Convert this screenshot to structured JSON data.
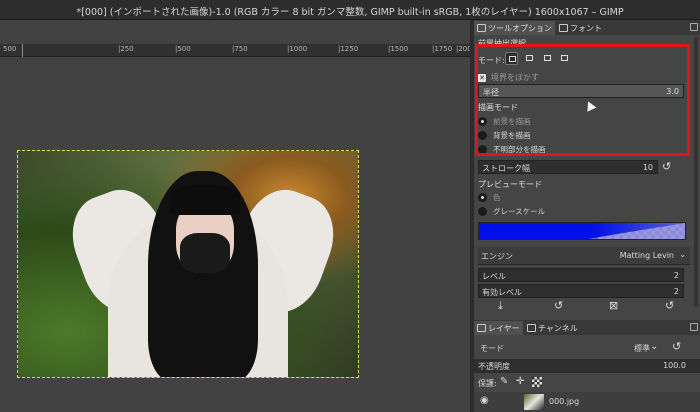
{
  "window": {
    "title": "*[000] (インポートされた画像)-1.0 (RGB カラー 8 bit ガンマ整数, GIMP built-in sRGB, 1枚のレイヤー) 1600x1067 – GIMP"
  },
  "ruler": {
    "labels": [
      "500",
      "|250",
      "|500",
      "|750",
      "|1000",
      "|1250",
      "|1500",
      "|1750",
      "|200"
    ]
  },
  "tool_options": {
    "tabs": [
      {
        "label": "ツールオプション",
        "icon": "tool-options-icon"
      },
      {
        "label": "フォント",
        "icon": "font-icon"
      }
    ],
    "section_title": "前景抽出選択",
    "mode_label": "モード:",
    "mode_buttons": [
      "replace-mode",
      "add-mode",
      "subtract-mode",
      "intersect-mode"
    ],
    "feather": {
      "label": "境界をぼかす",
      "checked": true
    },
    "radius": {
      "label": "半径",
      "value": "3.0"
    },
    "draw_mode": {
      "title": "描画モード",
      "options": [
        {
          "label": "前景を描画",
          "selected": true
        },
        {
          "label": "背景を描画",
          "selected": false
        },
        {
          "label": "不明部分を描画",
          "selected": false
        }
      ]
    },
    "stroke_width": {
      "label": "ストローク幅",
      "value": "10"
    },
    "preview_mode": {
      "title": "プレビューモード",
      "options": [
        {
          "label": "色",
          "selected": true
        },
        {
          "label": "グレースケール",
          "selected": false
        }
      ]
    },
    "preview_color": "#0010e8",
    "engine": {
      "label": "エンジン",
      "value": "Matting Levin"
    },
    "level": {
      "label": "レベル",
      "value": "2"
    },
    "active_levels": {
      "label": "有効レベル",
      "value": "2"
    }
  },
  "layers": {
    "tabs": [
      {
        "label": "レイヤー",
        "icon": "layers-icon"
      },
      {
        "label": "チャンネル",
        "icon": "channels-icon"
      }
    ],
    "mode_label": "モード",
    "mode_value": "標準",
    "opacity_label": "不透明度",
    "opacity_value": "100.0",
    "lock_label": "保護:",
    "layer_name": "000.jpg"
  },
  "colors": {
    "highlight": "#e0141f",
    "selection": "#e6d55a"
  }
}
